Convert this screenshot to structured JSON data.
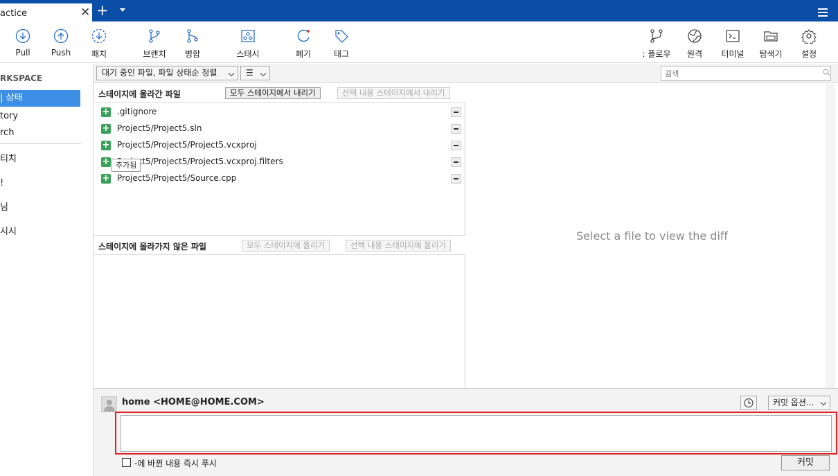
{
  "tab": {
    "title": "actice",
    "close": "✕",
    "add": "+"
  },
  "toolbar": {
    "pull": "Pull",
    "push": "Push",
    "fetch": "패치",
    "branch": "브랜치",
    "merge": "병합",
    "stash": "스태시",
    "discard": "폐기",
    "tag": "태그",
    "flow": ": 플로우",
    "remote": "원격",
    "terminal": "터미널",
    "explorer": "탐색기",
    "settings": "설정"
  },
  "sidebar": {
    "workspace": "RKSPACE",
    "items": [
      "| 상태",
      "tory",
      "rch"
    ],
    "groups": [
      "티치",
      "!",
      "님",
      "시시"
    ]
  },
  "filter": {
    "dropdown": "대기 중인 파일, 파일 상태순 정렬",
    "view": "☰",
    "search_placeholder": "검색"
  },
  "staged": {
    "title": "스테이지에 올라간 파일",
    "unstage_all": "모두 스테이지에서 내리기",
    "unstage_selected": "선택 내용 스테이지에서 내리기",
    "files": [
      ".gitignore",
      "Project5/Project5.sln",
      "Project5/Project5/Project5.vcxproj",
      "Project5/Project5/Project5.vcxproj.filters",
      "Project5/Project5/Source.cpp"
    ],
    "tooltip": "추가됨"
  },
  "unstaged": {
    "title": "스테이지에 올라가지 않은 파일",
    "stage_all": "모두 스테이지에 올리기",
    "stage_selected": "선택 내용 스테이지에 올리기"
  },
  "diff": {
    "message": "Select a file to view the diff"
  },
  "commit": {
    "author": "home <HOME@HOME.COM>",
    "options": "커밋 옵션...",
    "push_label": "-에 바뀐 내용 즉시 푸시",
    "button": "커밋"
  },
  "colors": {
    "titlebar": "#0a4ea8",
    "accent": "#3d8fe6",
    "added": "#3aa05a",
    "highlight": "#e12121"
  }
}
